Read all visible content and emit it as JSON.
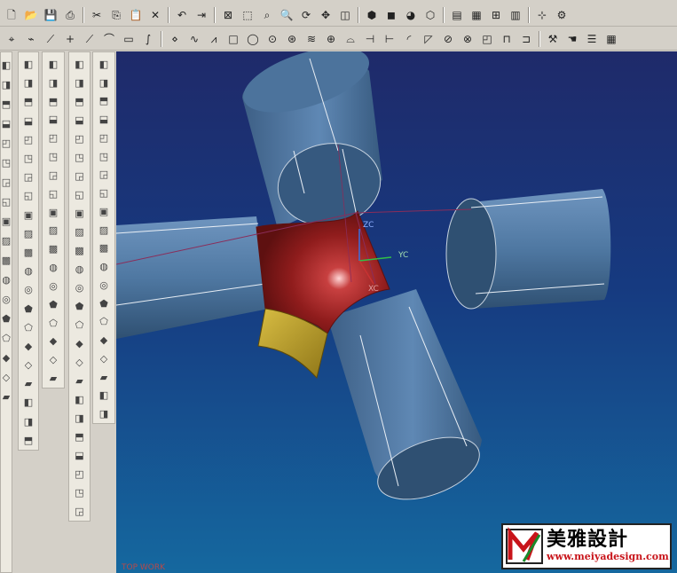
{
  "toolbar_top": {
    "buttons": [
      {
        "icon": "new-file-icon",
        "glyph": "🗋"
      },
      {
        "icon": "open-folder-icon",
        "glyph": "📂"
      },
      {
        "icon": "save-icon",
        "glyph": "💾"
      },
      {
        "icon": "print-icon",
        "glyph": "⎙"
      },
      {
        "sep": true
      },
      {
        "icon": "cut-icon",
        "glyph": "✂"
      },
      {
        "icon": "copy-icon",
        "glyph": "⎘"
      },
      {
        "icon": "paste-icon",
        "glyph": "📋"
      },
      {
        "icon": "delete-icon",
        "glyph": "✕"
      },
      {
        "sep": true
      },
      {
        "icon": "undo-icon",
        "glyph": "↶"
      },
      {
        "icon": "redo-icon",
        "glyph": "⇥"
      },
      {
        "sep": true
      },
      {
        "icon": "fit-view-icon",
        "glyph": "⊠"
      },
      {
        "icon": "zoom-window-icon",
        "glyph": "⬚"
      },
      {
        "icon": "zoom-area-icon",
        "glyph": "⌕"
      },
      {
        "icon": "zoom-icon",
        "glyph": "🔍"
      },
      {
        "icon": "rotate-icon",
        "glyph": "⟳"
      },
      {
        "icon": "pan-icon",
        "glyph": "✥"
      },
      {
        "icon": "perspective-icon",
        "glyph": "◫"
      },
      {
        "sep": true
      },
      {
        "icon": "shaded-cube-icon",
        "glyph": "⬢"
      },
      {
        "icon": "cyan-cube-icon",
        "glyph": "◼"
      },
      {
        "icon": "color-sphere-icon",
        "glyph": "◕"
      },
      {
        "icon": "wire-cube-icon",
        "glyph": "⬡"
      },
      {
        "sep": true
      },
      {
        "icon": "layer-icon",
        "glyph": "▤"
      },
      {
        "icon": "feature-icon",
        "glyph": "▦"
      },
      {
        "icon": "assembly-icon",
        "glyph": "⊞"
      },
      {
        "icon": "part-icon",
        "glyph": "▥"
      },
      {
        "sep": true
      },
      {
        "icon": "measure-icon",
        "glyph": "⊹"
      },
      {
        "icon": "analysis-icon",
        "glyph": "⚙"
      }
    ]
  },
  "toolbar_curve": {
    "buttons": [
      {
        "icon": "point-set-icon",
        "glyph": "⌖"
      },
      {
        "icon": "point-icon",
        "glyph": "⌁"
      },
      {
        "icon": "line-icon",
        "glyph": "⟋"
      },
      {
        "icon": "point-plus-icon",
        "glyph": "+"
      },
      {
        "icon": "line-angle-icon",
        "glyph": "⟋"
      },
      {
        "icon": "arc-icon",
        "glyph": "⌒"
      },
      {
        "icon": "rectangle-icon",
        "glyph": "▭"
      },
      {
        "icon": "spline-icon",
        "glyph": "∫"
      },
      {
        "sep": true
      },
      {
        "icon": "point-on-curve-icon",
        "glyph": "⋄"
      },
      {
        "icon": "curve-icon",
        "glyph": "∿"
      },
      {
        "icon": "polyline-icon",
        "glyph": "⩘"
      },
      {
        "icon": "square-icon",
        "glyph": "□"
      },
      {
        "icon": "circle-icon",
        "glyph": "◯"
      },
      {
        "icon": "target-icon",
        "glyph": "⊙"
      },
      {
        "icon": "helix-icon",
        "glyph": "⊛"
      },
      {
        "icon": "text-xyz-icon",
        "glyph": "≋"
      },
      {
        "icon": "offset-icon",
        "glyph": "⊕"
      },
      {
        "icon": "bridge-icon",
        "glyph": "⌓"
      },
      {
        "icon": "trim-icon",
        "glyph": "⊣"
      },
      {
        "icon": "extend-icon",
        "glyph": "⊢"
      },
      {
        "icon": "fillet-icon",
        "glyph": "◜"
      },
      {
        "icon": "chamfer-icon",
        "glyph": "◸"
      },
      {
        "icon": "divide-icon",
        "glyph": "⊘"
      },
      {
        "icon": "join-icon",
        "glyph": "⊗"
      },
      {
        "icon": "project-icon",
        "glyph": "◰"
      },
      {
        "icon": "intersect-icon",
        "glyph": "⊓"
      },
      {
        "icon": "section-icon",
        "glyph": "⊐"
      },
      {
        "sep": true
      },
      {
        "icon": "wrap-icon",
        "glyph": "⚒"
      },
      {
        "icon": "hand-icon",
        "glyph": "☚"
      },
      {
        "icon": "stack-icon",
        "glyph": "☰"
      },
      {
        "icon": "books-icon",
        "glyph": "▦"
      }
    ]
  },
  "palettes": [
    {
      "id": "pal1",
      "icons": [
        "sketch-icon",
        "edit-icon",
        "pen-icon",
        "arc-tool-icon",
        "fillet-tool-icon",
        "curve-tool-icon",
        "trim-tool-icon",
        "wave-tool-icon",
        "offset-tool-icon",
        "box-tool-icon",
        "surface-tool-icon",
        "blend-tool-icon",
        "grid-tool-icon",
        "shell-tool-icon",
        "chart-tool-icon",
        "gear-tool-icon",
        "cursor-tool-icon",
        "bend-tool-icon"
      ]
    },
    {
      "id": "pal2",
      "icons": [
        "extrude-icon",
        "revolve-icon",
        "datum-icon",
        "face-icon",
        "sweep-icon",
        "loft-icon",
        "tube-icon",
        "rib-icon",
        "draft-icon",
        "boss-icon",
        "pocket-icon",
        "slot-icon",
        "groove-icon",
        "hole-icon",
        "thread-icon",
        "pattern-icon",
        "mirror-icon",
        "scale-icon",
        "union-icon",
        "subtract-icon",
        "intersect-body-icon"
      ]
    },
    {
      "id": "pal3",
      "icons": [
        "split-icon",
        "ruled-icon",
        "mesh-icon",
        "patch-icon",
        "bound-icon",
        "n-sided-icon",
        "swept-face-icon",
        "styled-icon",
        "silhouette-icon",
        "law-icon",
        "transition-icon",
        "offset-face-icon",
        "trim-sheet-icon",
        "sew-icon",
        "quilt-icon",
        "thicken-icon",
        "shell-face-icon",
        "enlarge-icon"
      ]
    },
    {
      "id": "pal4",
      "icons": [
        "frame-icon",
        "cube-view-icon",
        "sweep-face-icon",
        "morph-icon",
        "surface-mesh-icon",
        "edge-blend-icon",
        "face-blend-icon",
        "soft-blend-icon",
        "variable-blend-icon",
        "cliff-blend-icon",
        "wave-surface-icon",
        "law-surface-icon",
        "curvature-icon",
        "draft-check-icon",
        "reflect-icon",
        "highlight-icon",
        "section-view-icon",
        "slope-icon",
        "radius-icon",
        "deviation-icon",
        "gap-icon",
        "box-solid-icon",
        "cube-solid-icon",
        "cone-icon",
        "sphere-icon"
      ]
    },
    {
      "id": "pal5",
      "icons": [
        "block-icon",
        "cylinder-icon",
        "cone-solid-icon",
        "sphere-solid-icon",
        "tube-solid-icon",
        "pad-icon",
        "pocket-solid-icon",
        "boss-solid-icon",
        "hole-solid-icon",
        "emboss-icon",
        "groove-solid-icon",
        "slot-solid-icon",
        "shell-solid-icon",
        "thread-solid-icon",
        "blend-solid-icon",
        "chamfer-solid-icon",
        "trim-body-icon",
        "split-body-icon",
        "extract-icon",
        "offset-body-icon"
      ]
    }
  ],
  "viewport": {
    "view_label": "TOP WORK",
    "axes": {
      "x": "XC",
      "y": "YC",
      "z": "ZC"
    },
    "colors": {
      "cylinder": "#4f78a2",
      "cylinder_dark": "#33557a",
      "elbow": "#8f1c1c",
      "yellow_face": "#b69a2a",
      "axis_x": "#c83232",
      "axis_y": "#31c047",
      "axis_z": "#3a6fe0"
    }
  },
  "watermark": {
    "brand_cn": "美雅設計",
    "url": "www.meiyadesign.com"
  }
}
